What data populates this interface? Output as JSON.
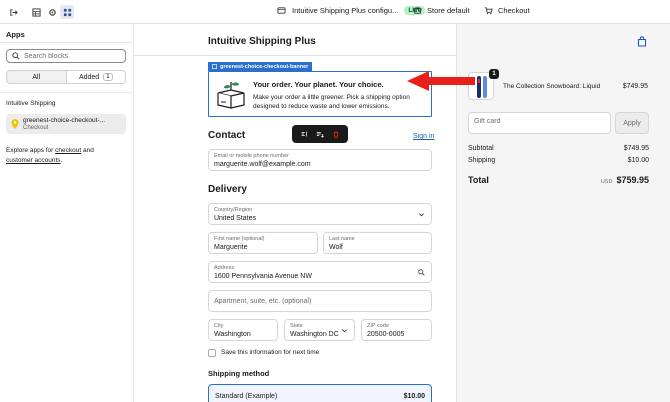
{
  "topbar": {
    "app_config": "Intuitive Shipping Plus configu...",
    "live": "Live",
    "store": "Store default",
    "checkout": "Checkout"
  },
  "sidebar": {
    "title": "Apps",
    "search_placeholder": "Search blocks",
    "tabs": {
      "all": "All",
      "added": "Added",
      "added_count": "1"
    },
    "section": "Intuitive Shipping",
    "app_item": {
      "name": "greenest-choice-checkout-...",
      "location": "Checkout"
    },
    "explore": {
      "prefix": "Explore apps for",
      "link1": "checkout",
      "and": "and",
      "link2": "customer accounts",
      "suffix": "."
    }
  },
  "checkout": {
    "store_title": "Intuitive Shipping Plus",
    "banner_tag": "greenest-choice-checkout-banner",
    "banner_title": "Your order. Your planet. Your choice.",
    "banner_text": "Make your order a little greener. Pick a shipping option designed to reduce waste and lower emissions.",
    "contact_heading": "Contact",
    "sign_in": "Sign in",
    "email": {
      "label": "Email or mobile phone number",
      "value": "marguerite.wolf@example.com"
    },
    "delivery_heading": "Delivery",
    "country": {
      "label": "Country/Region",
      "value": "United States"
    },
    "first_name": {
      "label": "First name (optional)",
      "value": "Marguerite"
    },
    "last_name": {
      "label": "Last name",
      "value": "Wolf"
    },
    "address": {
      "label": "Address",
      "value": "1600 Pennsylvania Avenue NW"
    },
    "apartment_placeholder": "Apartment, suite, etc. (optional)",
    "city": {
      "label": "City",
      "value": "Washington"
    },
    "state": {
      "label": "State",
      "value": "Washington DC"
    },
    "zip": {
      "label": "ZIP code",
      "value": "20500-0005"
    },
    "save_info": "Save this information for next time",
    "shipping_method_heading": "Shipping method",
    "shipping_option": {
      "name": "Standard (Example)",
      "price": "$10.00"
    }
  },
  "summary": {
    "quantity": "1",
    "product_name": "The Collection Snowboard: Liquid",
    "product_price": "$749.95",
    "gift_placeholder": "Gift card",
    "apply": "Apply",
    "subtotal_label": "Subtotal",
    "subtotal": "$749.95",
    "shipping_label": "Shipping",
    "shipping": "$10.00",
    "total_label": "Total",
    "currency": "USD",
    "total": "$759.95"
  },
  "colors": {
    "accent": "#2c6ecb",
    "arrow": "#e8201a",
    "live": "#b5f0c6"
  }
}
